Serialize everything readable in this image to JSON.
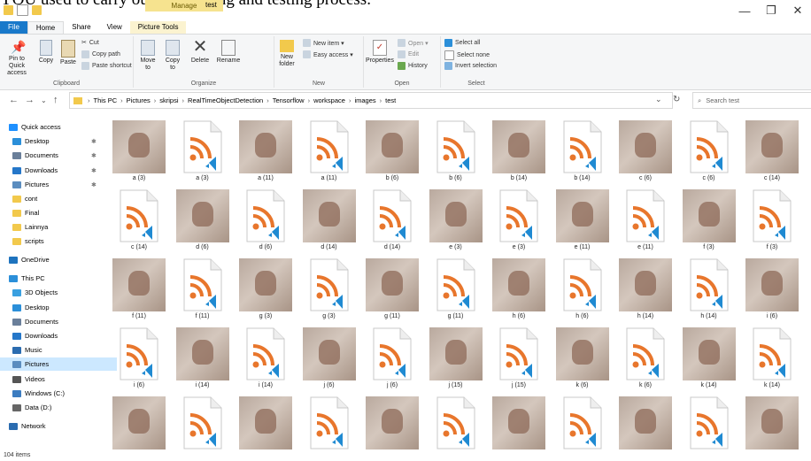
{
  "doc_text": "YOU used to carry out the training and testing process.",
  "title_bar": {
    "manage_tab": "Manage",
    "title": "test",
    "minimize": "—",
    "maximize": "❐",
    "close": "✕"
  },
  "tabs": [
    "File",
    "Home",
    "Share",
    "View",
    "Picture Tools"
  ],
  "ribbon": {
    "clipboard": {
      "pin": "Pin to Quick access",
      "copy": "Copy",
      "paste": "Paste",
      "cut": "Cut",
      "copy_path": "Copy path",
      "paste_shortcut": "Paste shortcut",
      "label": "Clipboard"
    },
    "organize": {
      "move_to": "Move to",
      "copy_to": "Copy to",
      "delete": "Delete",
      "rename": "Rename",
      "label": "Organize"
    },
    "new": {
      "new_folder": "New folder",
      "new_item": "New item ▾",
      "easy_access": "Easy access ▾",
      "label": "New"
    },
    "open": {
      "properties": "Properties",
      "open": "Open ▾",
      "edit": "Edit",
      "history": "History",
      "label": "Open"
    },
    "select": {
      "select_all": "Select all",
      "select_none": "Select none",
      "invert": "Invert selection",
      "label": "Select"
    }
  },
  "address": {
    "crumbs": [
      "This PC",
      "Pictures",
      "skripsi",
      "RealTimeObjectDetection",
      "Tensorflow",
      "workspace",
      "images",
      "test"
    ],
    "search_placeholder": "Search test"
  },
  "nav": [
    {
      "label": "Quick access",
      "icon": "star-icon",
      "color": "#1e90ff",
      "pinned": false
    },
    {
      "label": "Desktop",
      "icon": "desktop-icon",
      "color": "#2b8fd9",
      "pinned": true
    },
    {
      "label": "Documents",
      "icon": "documents-icon",
      "color": "#6a7f9a",
      "pinned": true
    },
    {
      "label": "Downloads",
      "icon": "download-icon",
      "color": "#2577c9",
      "pinned": true
    },
    {
      "label": "Pictures",
      "icon": "pictures-icon",
      "color": "#5b8dbf",
      "pinned": true
    },
    {
      "label": "cont",
      "icon": "folder-icon",
      "color": "#f2c94c",
      "pinned": false
    },
    {
      "label": "Final",
      "icon": "folder-icon",
      "color": "#f2c94c",
      "pinned": false
    },
    {
      "label": "Lainnya",
      "icon": "folder-icon",
      "color": "#f2c94c",
      "pinned": false
    },
    {
      "label": "scripts",
      "icon": "folder-icon",
      "color": "#f2c94c",
      "pinned": false
    },
    {
      "label": "OneDrive",
      "icon": "cloud-icon",
      "color": "#1e73be",
      "pinned": false
    },
    {
      "label": "This PC",
      "icon": "pc-icon",
      "color": "#2b8fd9",
      "pinned": false
    },
    {
      "label": "3D Objects",
      "icon": "cube-icon",
      "color": "#3aa0e0",
      "pinned": false
    },
    {
      "label": "Desktop",
      "icon": "desktop-icon",
      "color": "#2b8fd9",
      "pinned": false
    },
    {
      "label": "Documents",
      "icon": "documents-icon",
      "color": "#6a7f9a",
      "pinned": false
    },
    {
      "label": "Downloads",
      "icon": "download-icon",
      "color": "#2577c9",
      "pinned": false
    },
    {
      "label": "Music",
      "icon": "music-icon",
      "color": "#2b6cb0",
      "pinned": false
    },
    {
      "label": "Pictures",
      "icon": "pictures-icon",
      "color": "#5b8dbf",
      "pinned": false,
      "selected": true
    },
    {
      "label": "Videos",
      "icon": "video-icon",
      "color": "#555",
      "pinned": false
    },
    {
      "label": "Windows (C:)",
      "icon": "drive-icon",
      "color": "#3c7cc0",
      "pinned": false
    },
    {
      "label": "Data (D:)",
      "icon": "drive-icon",
      "color": "#666",
      "pinned": false
    },
    {
      "label": "Network",
      "icon": "network-icon",
      "color": "#2b6cb0",
      "pinned": false
    }
  ],
  "files": [
    {
      "name": "a (3)",
      "kind": "photo"
    },
    {
      "name": "a (3)",
      "kind": "xml"
    },
    {
      "name": "a (11)",
      "kind": "photo"
    },
    {
      "name": "a (11)",
      "kind": "xml"
    },
    {
      "name": "b (6)",
      "kind": "photo"
    },
    {
      "name": "b (6)",
      "kind": "xml"
    },
    {
      "name": "b (14)",
      "kind": "photo"
    },
    {
      "name": "b (14)",
      "kind": "xml"
    },
    {
      "name": "c (6)",
      "kind": "photo"
    },
    {
      "name": "c (6)",
      "kind": "xml"
    },
    {
      "name": "c (14)",
      "kind": "photo"
    },
    {
      "name": "c (14)",
      "kind": "xml"
    },
    {
      "name": "d (6)",
      "kind": "photo"
    },
    {
      "name": "d (6)",
      "kind": "xml"
    },
    {
      "name": "d (14)",
      "kind": "photo"
    },
    {
      "name": "d (14)",
      "kind": "xml"
    },
    {
      "name": "e (3)",
      "kind": "photo"
    },
    {
      "name": "e (3)",
      "kind": "xml"
    },
    {
      "name": "e (11)",
      "kind": "photo"
    },
    {
      "name": "e (11)",
      "kind": "xml"
    },
    {
      "name": "f (3)",
      "kind": "photo"
    },
    {
      "name": "f (3)",
      "kind": "xml"
    },
    {
      "name": "f (11)",
      "kind": "photo"
    },
    {
      "name": "f (11)",
      "kind": "xml"
    },
    {
      "name": "g (3)",
      "kind": "photo"
    },
    {
      "name": "g (3)",
      "kind": "xml"
    },
    {
      "name": "g (11)",
      "kind": "photo"
    },
    {
      "name": "g (11)",
      "kind": "xml"
    },
    {
      "name": "h (6)",
      "kind": "photo"
    },
    {
      "name": "h (6)",
      "kind": "xml"
    },
    {
      "name": "h (14)",
      "kind": "photo"
    },
    {
      "name": "h (14)",
      "kind": "xml"
    },
    {
      "name": "i (6)",
      "kind": "photo"
    },
    {
      "name": "i (6)",
      "kind": "xml"
    },
    {
      "name": "i (14)",
      "kind": "photo"
    },
    {
      "name": "i (14)",
      "kind": "xml"
    },
    {
      "name": "j (6)",
      "kind": "photo"
    },
    {
      "name": "j (6)",
      "kind": "xml"
    },
    {
      "name": "j (15)",
      "kind": "photo"
    },
    {
      "name": "j (15)",
      "kind": "xml"
    },
    {
      "name": "k (6)",
      "kind": "photo"
    },
    {
      "name": "k (6)",
      "kind": "xml"
    },
    {
      "name": "k (14)",
      "kind": "photo"
    },
    {
      "name": "k (14)",
      "kind": "xml"
    },
    {
      "name": "",
      "kind": "photo"
    },
    {
      "name": "",
      "kind": "xml"
    },
    {
      "name": "",
      "kind": "photo"
    },
    {
      "name": "",
      "kind": "xml"
    },
    {
      "name": "",
      "kind": "photo"
    },
    {
      "name": "",
      "kind": "xml"
    },
    {
      "name": "",
      "kind": "photo"
    },
    {
      "name": "",
      "kind": "xml"
    },
    {
      "name": "",
      "kind": "photo"
    },
    {
      "name": "",
      "kind": "xml"
    },
    {
      "name": "",
      "kind": "photo"
    }
  ],
  "status": {
    "items": "104 items"
  },
  "colors": {
    "rss_orange": "#e8762c",
    "vscode_blue": "#1f8ad2",
    "accent": "#1979ca",
    "selection": "#cce8ff"
  }
}
